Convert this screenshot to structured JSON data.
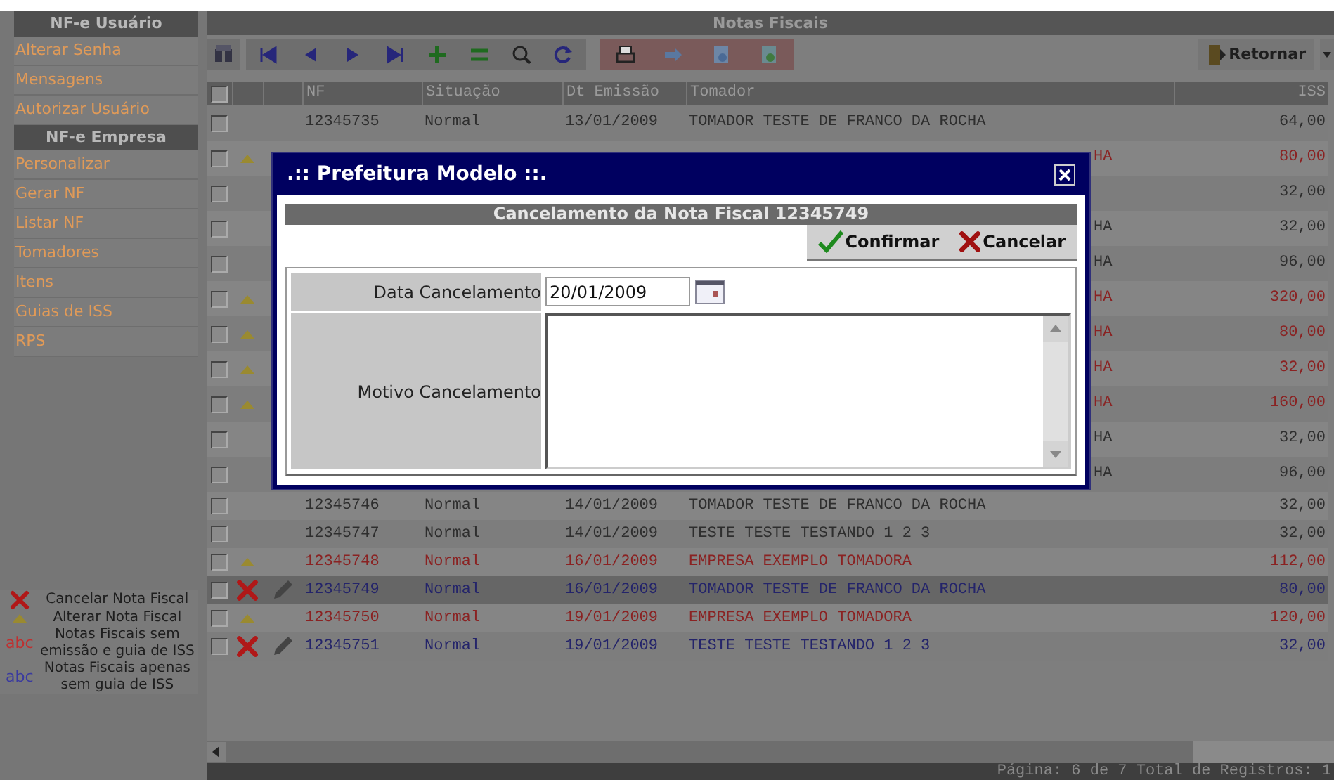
{
  "sidebar": {
    "sections": [
      {
        "title": "NF-e Usuário",
        "items": [
          "Alterar Senha",
          "Mensagens",
          "Autorizar Usuário"
        ]
      },
      {
        "title": "NF-e Empresa",
        "items": [
          "Personalizar",
          "Gerar NF",
          "Listar NF",
          "Tomadores",
          "Itens",
          "Guias de ISS",
          "RPS"
        ]
      }
    ],
    "legend": [
      {
        "kind": "cancel",
        "label": "Cancelar Nota Fiscal"
      },
      {
        "kind": "alter",
        "label": "Alterar Nota Fiscal"
      },
      {
        "kind": "swatch",
        "swatch": "abc",
        "color": "#c03030",
        "label": "Notas Fiscais sem emissão e guia de ISS"
      },
      {
        "kind": "swatch",
        "swatch": "abc",
        "color": "#3a3aa0",
        "label": "Notas Fiscais apenas sem guia de ISS"
      }
    ]
  },
  "panel": {
    "title": "Notas Fiscais",
    "return_button": "Retornar"
  },
  "table": {
    "all_checked": false,
    "columns": [
      "NF",
      "Situação",
      "Dt Emissão",
      "Tomador",
      "ISS"
    ],
    "rows": [
      {
        "nf": "12345735",
        "situacao": "Normal",
        "emissao": "13/01/2009",
        "tomador": "TOMADOR TESTE DE FRANCO DA ROCHA",
        "iss": "64,00",
        "color": "#2e2e2e",
        "kind": "plain",
        "checked": false,
        "selected": false
      },
      {
        "tomador": "HA",
        "iss": "80,00",
        "color": "#8a2222",
        "kind": "alter",
        "checked": false,
        "selected": false
      },
      {
        "iss": "32,00",
        "color": "#2e2e2e",
        "kind": "plain",
        "checked": false,
        "selected": false
      },
      {
        "tomador": "HA",
        "iss": "32,00",
        "color": "#2e2e2e",
        "kind": "plain",
        "checked": false,
        "selected": false
      },
      {
        "tomador": "HA",
        "iss": "96,00",
        "color": "#2e2e2e",
        "kind": "plain",
        "checked": false,
        "selected": false
      },
      {
        "tomador": "HA",
        "iss": "320,00",
        "color": "#8a2222",
        "kind": "alter",
        "checked": false,
        "selected": false
      },
      {
        "tomador": "HA",
        "iss": "80,00",
        "color": "#8a2222",
        "kind": "alter",
        "checked": false,
        "selected": false
      },
      {
        "tomador": "HA",
        "iss": "32,00",
        "color": "#8a2222",
        "kind": "alter",
        "checked": false,
        "selected": false
      },
      {
        "tomador": "HA",
        "iss": "160,00",
        "color": "#8a2222",
        "kind": "alter",
        "checked": false,
        "selected": false
      },
      {
        "tomador": "HA",
        "iss": "32,00",
        "color": "#2e2e2e",
        "kind": "plain",
        "checked": false,
        "selected": false
      },
      {
        "tomador": "HA",
        "iss": "96,00",
        "color": "#2e2e2e",
        "kind": "plain",
        "checked": false,
        "selected": false
      },
      {
        "nf": "12345746",
        "situacao": "Normal",
        "emissao": "14/01/2009",
        "tomador": "TOMADOR TESTE DE FRANCO DA ROCHA",
        "iss": "32,00",
        "color": "#2e2e2e",
        "kind": "plain",
        "checked": false,
        "selected": false
      },
      {
        "nf": "12345747",
        "situacao": "Normal",
        "emissao": "14/01/2009",
        "tomador": "TESTE TESTE TESTANDO 1 2 3",
        "iss": "32,00",
        "color": "#2e2e2e",
        "kind": "plain",
        "checked": false,
        "selected": false
      },
      {
        "nf": "12345748",
        "situacao": "Normal",
        "emissao": "16/01/2009",
        "tomador": "EMPRESA EXEMPLO TOMADORA",
        "iss": "112,00",
        "color": "#8a2222",
        "kind": "alter",
        "checked": false,
        "selected": false
      },
      {
        "nf": "12345749",
        "situacao": "Normal",
        "emissao": "16/01/2009",
        "tomador": "TOMADOR TESTE DE FRANCO DA ROCHA",
        "iss": "80,00",
        "color": "#24246a",
        "kind": "cancel",
        "checked": false,
        "selected": true
      },
      {
        "nf": "12345750",
        "situacao": "Normal",
        "emissao": "19/01/2009",
        "tomador": "EMPRESA EXEMPLO TOMADORA",
        "iss": "120,00",
        "color": "#8a2222",
        "kind": "alter",
        "checked": false,
        "selected": false
      },
      {
        "nf": "12345751",
        "situacao": "Normal",
        "emissao": "19/01/2009",
        "tomador": "TESTE TESTE TESTANDO 1 2 3",
        "iss": "32,00",
        "color": "#24246a",
        "kind": "cancel",
        "checked": false,
        "selected": false
      }
    ]
  },
  "footer": "Página: 6 de 7 Total de Registros: 1",
  "dialog": {
    "title": ".:: Prefeitura Modelo ::.",
    "heading": "Cancelamento da Nota Fiscal 12345749",
    "confirm": "Confirmar",
    "cancel": "Cancelar",
    "fields": [
      {
        "kind": "date",
        "label": "Data Cancelamento",
        "value": "20/01/2009"
      },
      {
        "kind": "textarea",
        "label": "Motivo Cancelamento"
      }
    ]
  }
}
